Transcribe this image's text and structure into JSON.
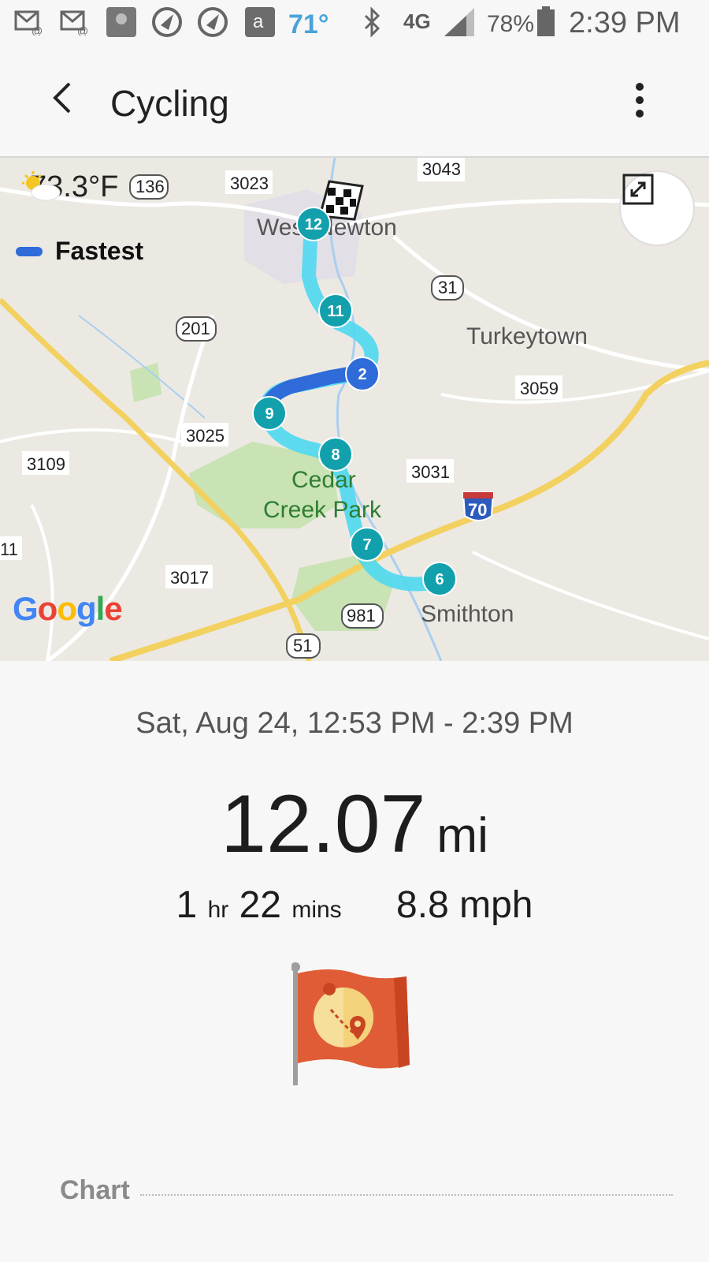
{
  "status_bar": {
    "temperature": "71°",
    "network": "4G",
    "battery": "78%",
    "time": "2:39 PM",
    "icons": [
      "email-notification-icon",
      "email-notification-icon",
      "sports-app-icon",
      "app-icon",
      "app-icon",
      "amazon-icon",
      "bluetooth-icon",
      "lte-icon",
      "signal-icon",
      "battery-icon"
    ]
  },
  "app_bar": {
    "title": "Cycling"
  },
  "map": {
    "weather": "73.3°F",
    "legend": "Fastest",
    "attribution": "Google",
    "place_labels": [
      "West Newton",
      "Turkeytown",
      "Cedar",
      "Creek Park",
      "Smithton"
    ],
    "road_labels": [
      "136",
      "3023",
      "3043",
      "31",
      "201",
      "3059",
      "3025",
      "3031",
      "3109",
      "70",
      "11",
      "3017",
      "981",
      "51"
    ],
    "markers": [
      "12",
      "11",
      "2",
      "9",
      "8",
      "7",
      "6"
    ],
    "colors": {
      "route": "#34c8e8",
      "fastest": "#2f6bd9",
      "marker": "#13a0ad"
    }
  },
  "workout": {
    "datetime": "Sat, Aug 24, 12:53 PM - 2:39 PM",
    "distance_value": "12.07",
    "distance_unit": "mi",
    "duration_hr": "1",
    "duration_hr_unit": "hr",
    "duration_min": "22",
    "duration_min_unit": "mins",
    "speed": "8.8 mph"
  },
  "chart_section": {
    "label": "Chart"
  }
}
